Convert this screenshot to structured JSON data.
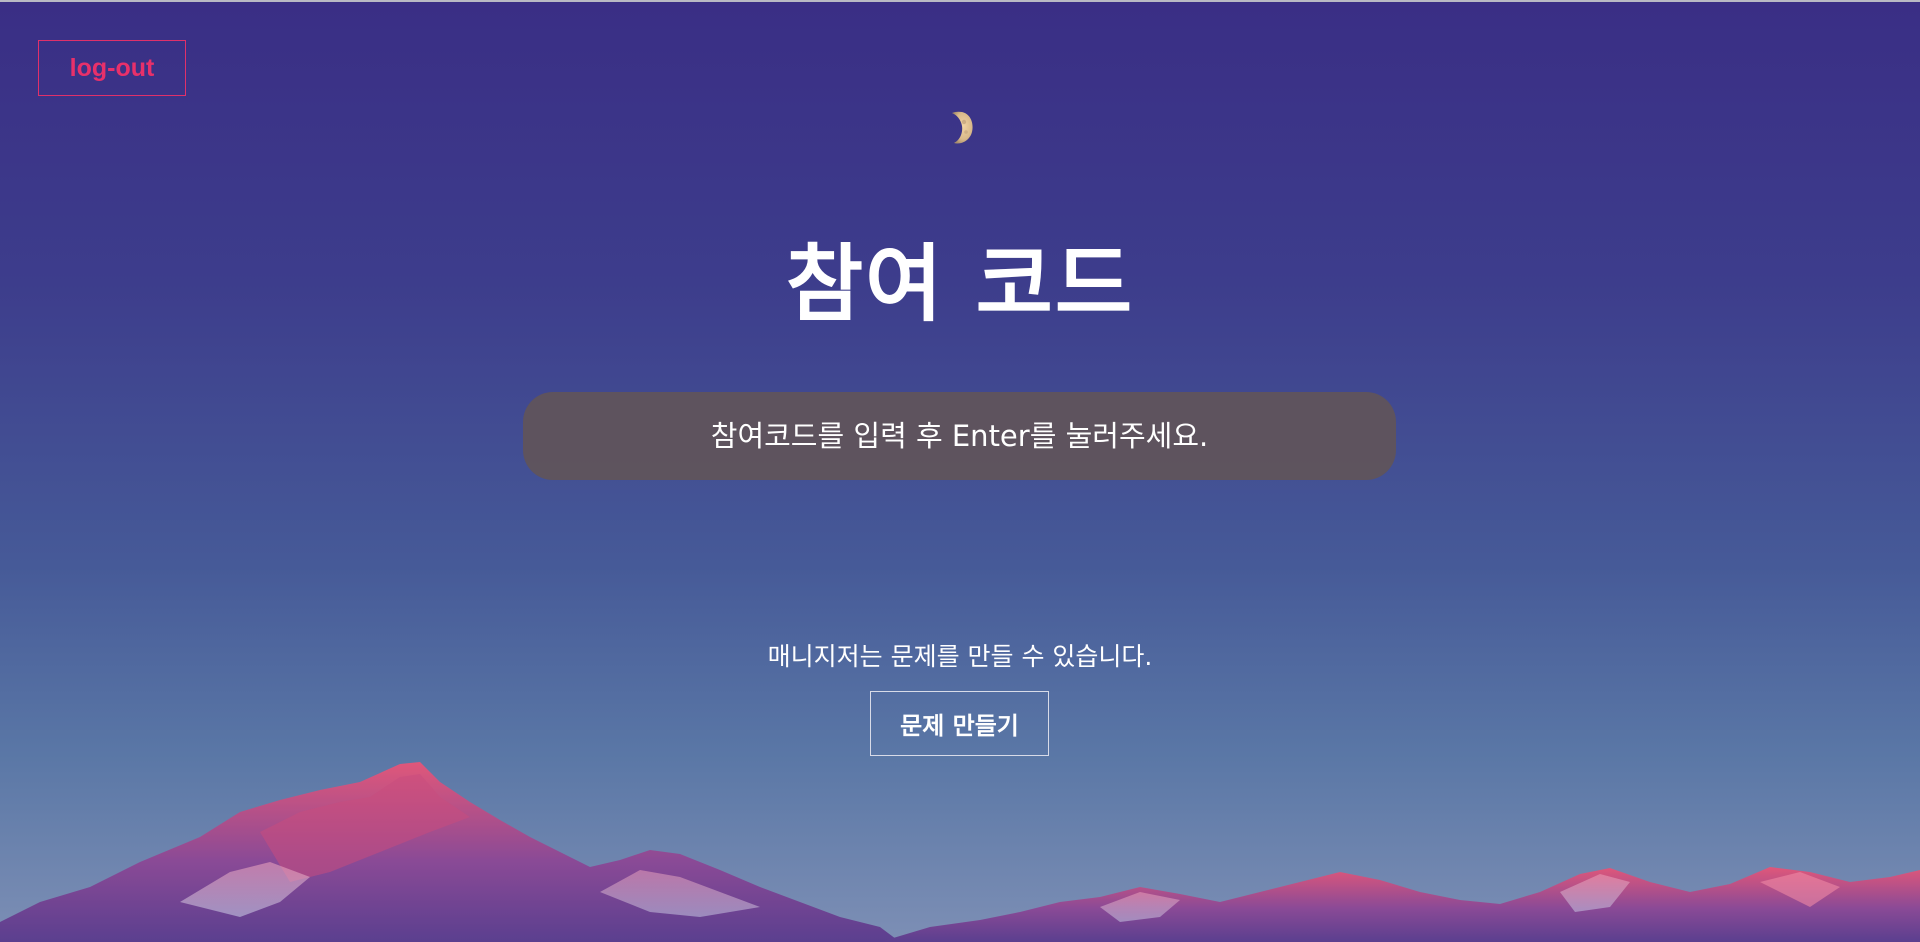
{
  "header": {
    "logout_label": "log-out"
  },
  "main": {
    "title": "참여 코드",
    "code_input": {
      "placeholder": "참여코드를 입력 후 Enter를 눌러주세요.",
      "value": ""
    },
    "manager_note": "매니지저는 문제를 만들 수 있습니다.",
    "create_button_label": "문제 만들기"
  },
  "background": {
    "sky_colors": [
      "#3a2e85",
      "#465a98",
      "#7d8fb5"
    ],
    "mountain_colors": [
      "#e0577a",
      "#5b3f8f",
      "#cdd3ea"
    ],
    "moon_color": "#d9b98a"
  },
  "colors": {
    "logout_accent": "#e8306a",
    "input_background": "#625456",
    "text": "#ffffff"
  }
}
